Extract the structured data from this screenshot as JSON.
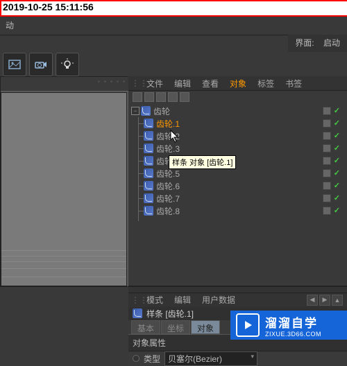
{
  "timestamp": "2019-10-25 15:11:56",
  "top_menu": {
    "animation": "动"
  },
  "interface": {
    "label": "界面:",
    "value": "启动"
  },
  "object_manager": {
    "menus": {
      "file": "文件",
      "edit": "编辑",
      "view": "查看",
      "object": "对象",
      "tags": "标签",
      "bookmarks": "书签"
    },
    "root": {
      "name": "齿轮"
    },
    "children": [
      {
        "name": "齿轮.1",
        "selected": true
      },
      {
        "name": "齿轮.2"
      },
      {
        "name": "齿轮.3"
      },
      {
        "name": "齿轮.4"
      },
      {
        "name": "齿轮.5"
      },
      {
        "name": "齿轮.6"
      },
      {
        "name": "齿轮.7"
      },
      {
        "name": "齿轮.8"
      }
    ]
  },
  "tooltip": "样条 对象 [齿轮.1]",
  "attributes": {
    "menus": {
      "mode": "模式",
      "edit": "编辑",
      "userdata": "用户数据"
    },
    "object_title": "样条 [齿轮.1]",
    "tabs": {
      "basic": "基本",
      "coord": "坐标",
      "object": "对象"
    },
    "section": "对象属性",
    "type_label": "类型",
    "type_value": "贝塞尔(Bezier)"
  },
  "watermark": {
    "cn": "溜溜自学",
    "url": "ZIXUE.3D66.COM"
  }
}
